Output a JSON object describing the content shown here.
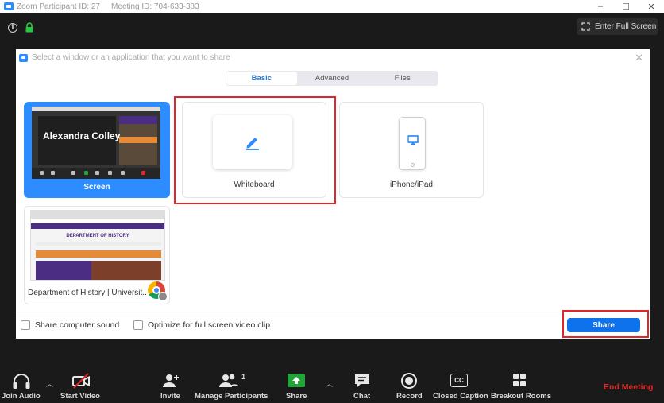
{
  "window": {
    "title": "Zoom Participant ID: 27",
    "meeting_id": "Meeting ID: 704-633-383",
    "controls": [
      "–",
      "☐",
      "✕"
    ]
  },
  "top_bar": {
    "fullscreen_label": "Enter Full Screen"
  },
  "share_dialog": {
    "title": "Select a window or an application that you want to share",
    "close": "✕",
    "tabs": [
      {
        "label": "Basic",
        "active": true
      },
      {
        "label": "Advanced",
        "active": false
      },
      {
        "label": "Files",
        "active": false
      }
    ],
    "tiles": {
      "screen": {
        "label": "Screen",
        "thumb_name": "Alexandra Colley",
        "selected": true
      },
      "whiteboard": {
        "label": "Whiteboard"
      },
      "iphone": {
        "label": "iPhone/iPad"
      },
      "browser": {
        "label": "Department of History | Universit...",
        "thumb_heading": "DEPARTMENT OF HISTORY"
      }
    },
    "options": {
      "share_sound": "Share computer sound",
      "optimize_video": "Optimize for full screen video clip"
    },
    "share_button": "Share"
  },
  "toolbar": {
    "items": [
      {
        "label": "Join Audio"
      },
      {
        "label": "Start Video"
      },
      {
        "label": "Invite"
      },
      {
        "label": "Manage Participants",
        "count": "1"
      },
      {
        "label": "Share"
      },
      {
        "label": "Chat"
      },
      {
        "label": "Record"
      },
      {
        "label": "Closed Caption",
        "icon_text": "CC"
      },
      {
        "label": "Breakout Rooms"
      }
    ],
    "end_meeting": "End Meeting"
  },
  "colors": {
    "accent": "#0e72ed",
    "zoom_blue": "#2d8cff",
    "highlight_red": "#e0262b",
    "share_green": "#23a33a",
    "end_red": "#e02828"
  }
}
